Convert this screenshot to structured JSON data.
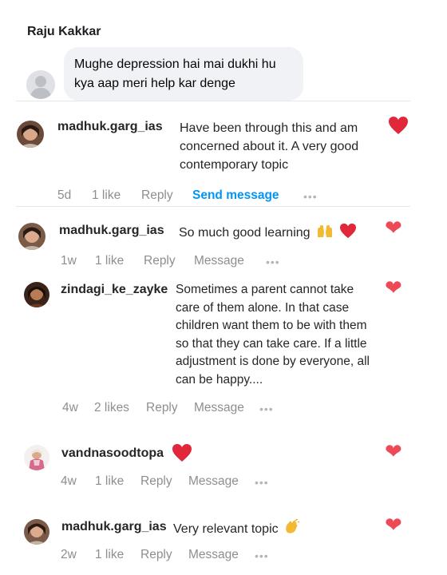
{
  "facebook_post": {
    "author": "Raju Kakkar",
    "comment": "Mughe depression hai mai dukhi hu kya aap meri help kar denge"
  },
  "comments": [
    {
      "username": "madhuk.garg_ias",
      "text": "Have been through this and am concerned about it. A very good contemporary topic",
      "time": "5d",
      "likes": "1 like",
      "reply": "Reply",
      "action": "Send message"
    },
    {
      "username": "madhuk.garg_ias",
      "text": "So much good learning",
      "time": "1w",
      "likes": "1 like",
      "reply": "Reply",
      "action": "Message"
    },
    {
      "username": "zindagi_ke_zayke",
      "text": "Sometimes a parent cannot take care of them alone. In that case children want them to be with them so that they can take care. If a little adjustment is done by everyone, all can be happy....",
      "time": "4w",
      "likes": "2 likes",
      "reply": "Reply",
      "action": "Message"
    },
    {
      "username": "vandnasoodtopa",
      "text": "",
      "time": "4w",
      "likes": "1 like",
      "reply": "Reply",
      "action": "Message"
    },
    {
      "username": "madhuk.garg_ias",
      "text": "Very relevant topic",
      "time": "2w",
      "likes": "1 like",
      "reply": "Reply",
      "action": "Message"
    }
  ],
  "icons": {
    "like": "heart-icon",
    "more": "more-options-icon",
    "emoji_heart": "red-heart-emoji",
    "emoji_raised_hands": "raising-hands-emoji",
    "emoji_clap": "clapping-hands-emoji"
  },
  "colors": {
    "heart": "#ed4956",
    "link_blue": "#0095f6",
    "meta_gray": "#8e8e8e"
  }
}
